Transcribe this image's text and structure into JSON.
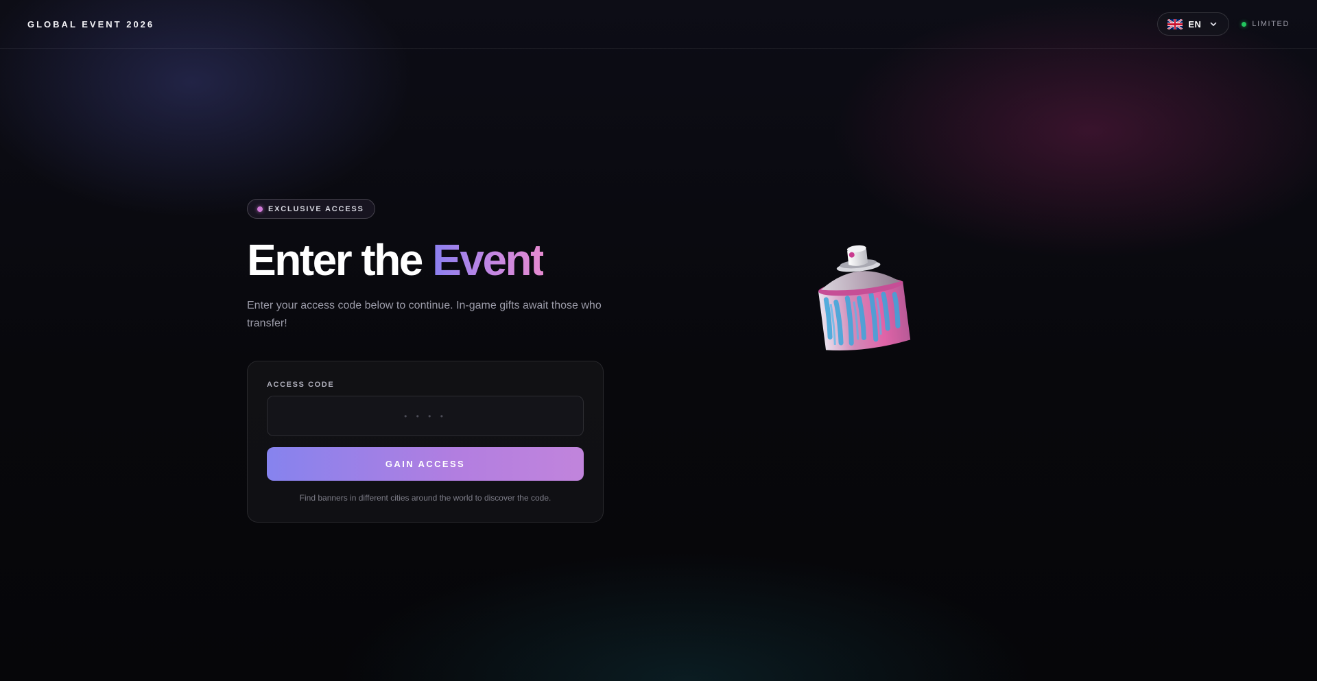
{
  "header": {
    "brand": "GLOBAL EVENT 2026",
    "language": {
      "code": "EN",
      "flag_icon": "uk-flag-icon",
      "chevron_icon": "chevron-down-icon"
    },
    "status": {
      "label": "LIMITED",
      "dot_color": "#22c55e"
    }
  },
  "hero": {
    "badge": "EXCLUSIVE ACCESS",
    "title_plain": "Enter the ",
    "title_accent": "Event",
    "subtitle": "Enter your access code below to continue. In-game gifts await those who transfer!"
  },
  "access_form": {
    "field_label": "ACCESS CODE",
    "placeholder": "• • • •",
    "button_label": "GAIN ACCESS",
    "hint": "Find banners in different cities around the world to discover the code."
  },
  "illustration": {
    "icon": "spray-can-icon"
  },
  "colors": {
    "background": "#07070b",
    "accent_start": "#8683ee",
    "accent_end": "#c184dc",
    "badge_dot": "#d07ad8"
  }
}
